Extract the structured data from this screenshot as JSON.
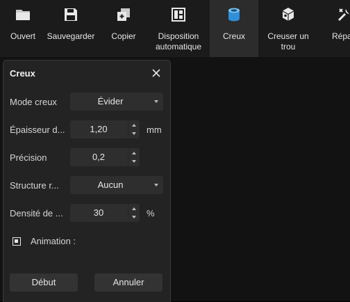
{
  "toolbar": {
    "items": [
      {
        "label": "Ouvert",
        "icon": "folder-icon"
      },
      {
        "label": "Sauvegarder",
        "icon": "save-icon"
      },
      {
        "label": "Copier",
        "icon": "copy-icon"
      },
      {
        "label": "Disposition automatique",
        "icon": "layout-icon"
      },
      {
        "label": "Creux",
        "icon": "hollow-icon",
        "active": true
      },
      {
        "label": "Creuser un trou",
        "icon": "dig-hole-icon"
      },
      {
        "label": "Répar",
        "icon": "repair-icon"
      }
    ]
  },
  "dialog": {
    "title": "Creux",
    "fields": {
      "mode": {
        "label": "Mode creux",
        "value": "Évider"
      },
      "thickness": {
        "label": "Épaisseur d...",
        "value": "1,20",
        "unit": "mm"
      },
      "precision": {
        "label": "Précision",
        "value": "0,2"
      },
      "structure": {
        "label": "Structure r...",
        "value": "Aucun"
      },
      "density": {
        "label": "Densité de ...",
        "value": "30",
        "unit": "%"
      }
    },
    "animation": {
      "label": "Animation :",
      "checked": true
    },
    "buttons": {
      "start": "Début",
      "cancel": "Annuler"
    }
  },
  "colors": {
    "accent": "#2f8fd8",
    "panel": "#232323",
    "toolbar": "#1b1b1b"
  }
}
